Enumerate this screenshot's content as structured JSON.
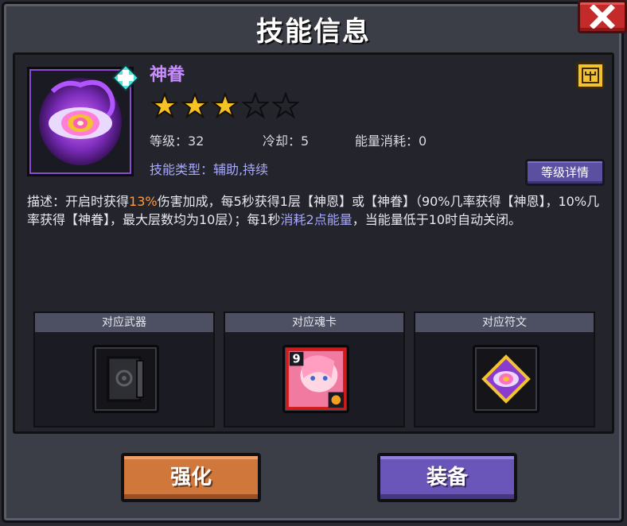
{
  "window": {
    "title": "技能信息"
  },
  "skill": {
    "name": "神眷",
    "stars_filled": 3,
    "stars_total": 5,
    "level_label": "等级：",
    "level_value": "32",
    "cooldown_label": "冷却：",
    "cooldown_value": "5",
    "energy_label": "能量消耗：",
    "energy_value": "0",
    "type_line": "技能类型：辅助,持续",
    "level_detail_button": "等级详情"
  },
  "description": {
    "part1": "描述：开启时获得",
    "highlight1": "13%",
    "part2": "伤害加成，每5秒获得1层【神恩】或【神眷】（90%几率获得【神恩】，10%几率获得【神眷】，最大层数均为10层）；每1秒",
    "highlight2": "消耗2点能量",
    "part3": "，当能量低于10时自动关闭。"
  },
  "slots": [
    {
      "label": "对应武器",
      "icon": "dark-book-icon"
    },
    {
      "label": "对应魂卡",
      "icon": "soul-card-icon",
      "card_level": "9"
    },
    {
      "label": "对应符文",
      "icon": "rune-eye-icon"
    }
  ],
  "buttons": {
    "strengthen": "强化",
    "equip": "装备"
  },
  "colors": {
    "skill_name": "#c98cff",
    "highlight_orange": "#ff9a3c",
    "highlight_purple": "#a7a7ff",
    "strengthen_button": "#d0773c",
    "equip_button": "#6a55b8",
    "close_button": "#c42a2a"
  }
}
